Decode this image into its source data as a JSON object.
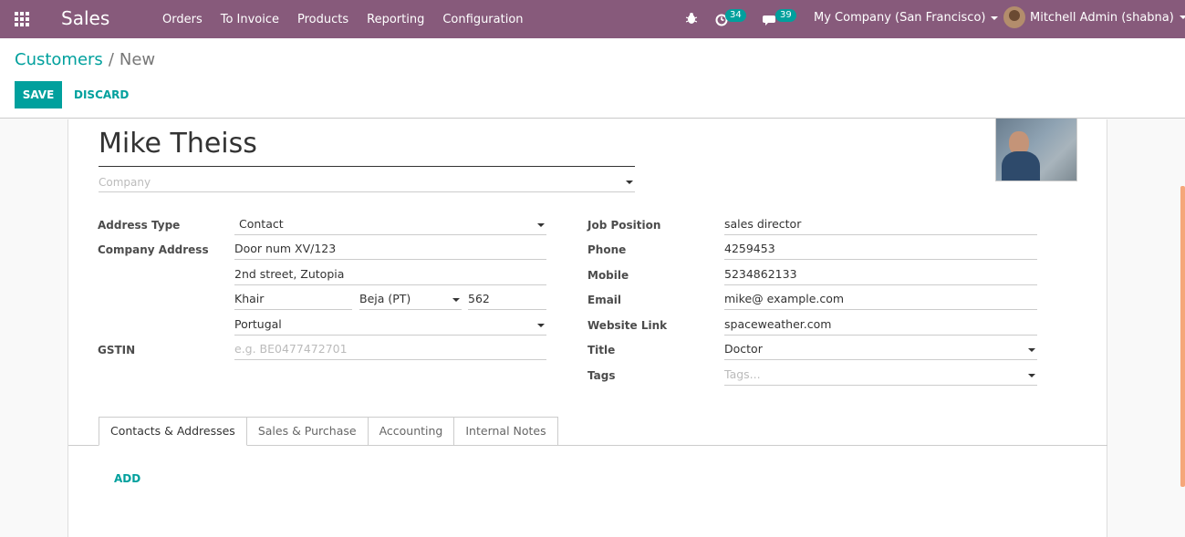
{
  "navbar": {
    "app_title": "Sales",
    "menu": [
      "Orders",
      "To Invoice",
      "Products",
      "Reporting",
      "Configuration"
    ],
    "activity_count": "34",
    "message_count": "39",
    "company": "My Company (San Francisco)",
    "user": "Mitchell Admin (shabna)"
  },
  "breadcrumb": {
    "parent": "Customers",
    "separator": "/",
    "current": "New"
  },
  "buttons": {
    "save": "SAVE",
    "discard": "DISCARD"
  },
  "form": {
    "name": "Mike Theiss",
    "company_placeholder": "Company",
    "labels": {
      "address_type": "Address Type",
      "company_address": "Company Address",
      "gstin": "GSTIN",
      "job_position": "Job Position",
      "phone": "Phone",
      "mobile": "Mobile",
      "email": "Email",
      "website": "Website Link",
      "title": "Title",
      "tags": "Tags"
    },
    "values": {
      "address_type": "Contact",
      "street": "Door num XV/123",
      "street2": "2nd street, Zutopia",
      "city": "Khair",
      "state": "Beja (PT)",
      "zip": "562",
      "country": "Portugal",
      "gstin_placeholder": "e.g. BE0477472701",
      "job_position": "sales director",
      "phone": "4259453",
      "mobile": "5234862133",
      "email": "mike@ example.com",
      "website": "spaceweather.com",
      "title": "Doctor",
      "tags_placeholder": "Tags..."
    }
  },
  "tabs": [
    "Contacts & Addresses",
    "Sales & Purchase",
    "Accounting",
    "Internal Notes"
  ],
  "add_label": "ADD"
}
